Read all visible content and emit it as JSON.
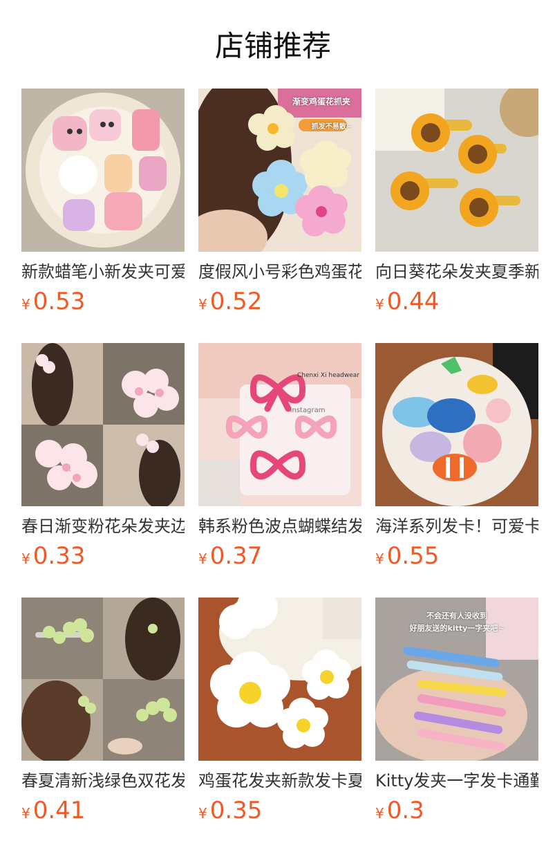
{
  "page_title": "店铺推荐",
  "currency_symbol": "¥",
  "products": [
    {
      "title": "新款蜡笔小新发夹可爱",
      "price": "0.53",
      "image": "crayon-shinchan-hairclips-photo",
      "image_text": ""
    },
    {
      "title": "度假风小号彩色鸡蛋花",
      "price": "0.52",
      "image": "plumeria-claw-clip-photo",
      "image_text": "渐变鸡蛋花抓夹",
      "image_badge": "抓发不易散~"
    },
    {
      "title": "向日葵花朵发夹夏季新",
      "price": "0.44",
      "image": "sunflower-hairclips-photo",
      "image_text": ""
    },
    {
      "title": "春日渐变粉花朵发夹边",
      "price": "0.33",
      "image": "pink-blossom-hairclips-photo",
      "image_text": ""
    },
    {
      "title": "韩系粉色波点蝴蝶结发",
      "price": "0.37",
      "image": "pink-bow-hairclips-photo",
      "image_text": "Chenxi Xi headwear",
      "image_badge": "Instagram"
    },
    {
      "title": "海洋系列发卡！可爱卡",
      "price": "0.55",
      "image": "ocean-animal-hairclips-photo",
      "image_text": ""
    },
    {
      "title": "春夏清新浅绿色双花发",
      "price": "0.41",
      "image": "green-flower-hairclips-photo",
      "image_text": ""
    },
    {
      "title": "鸡蛋花发夹新款发卡夏",
      "price": "0.35",
      "image": "white-plumeria-hairclips-photo",
      "image_text": ""
    },
    {
      "title": "Kitty发夹一字发卡通勤",
      "price": "0.3",
      "image": "kitty-hairpins-photo",
      "image_text": "不会还有人没收到",
      "image_badge": "好朋友送的kitty一字夹吧~"
    }
  ],
  "colors": {
    "price": "#f15a24",
    "title": "#333333"
  }
}
